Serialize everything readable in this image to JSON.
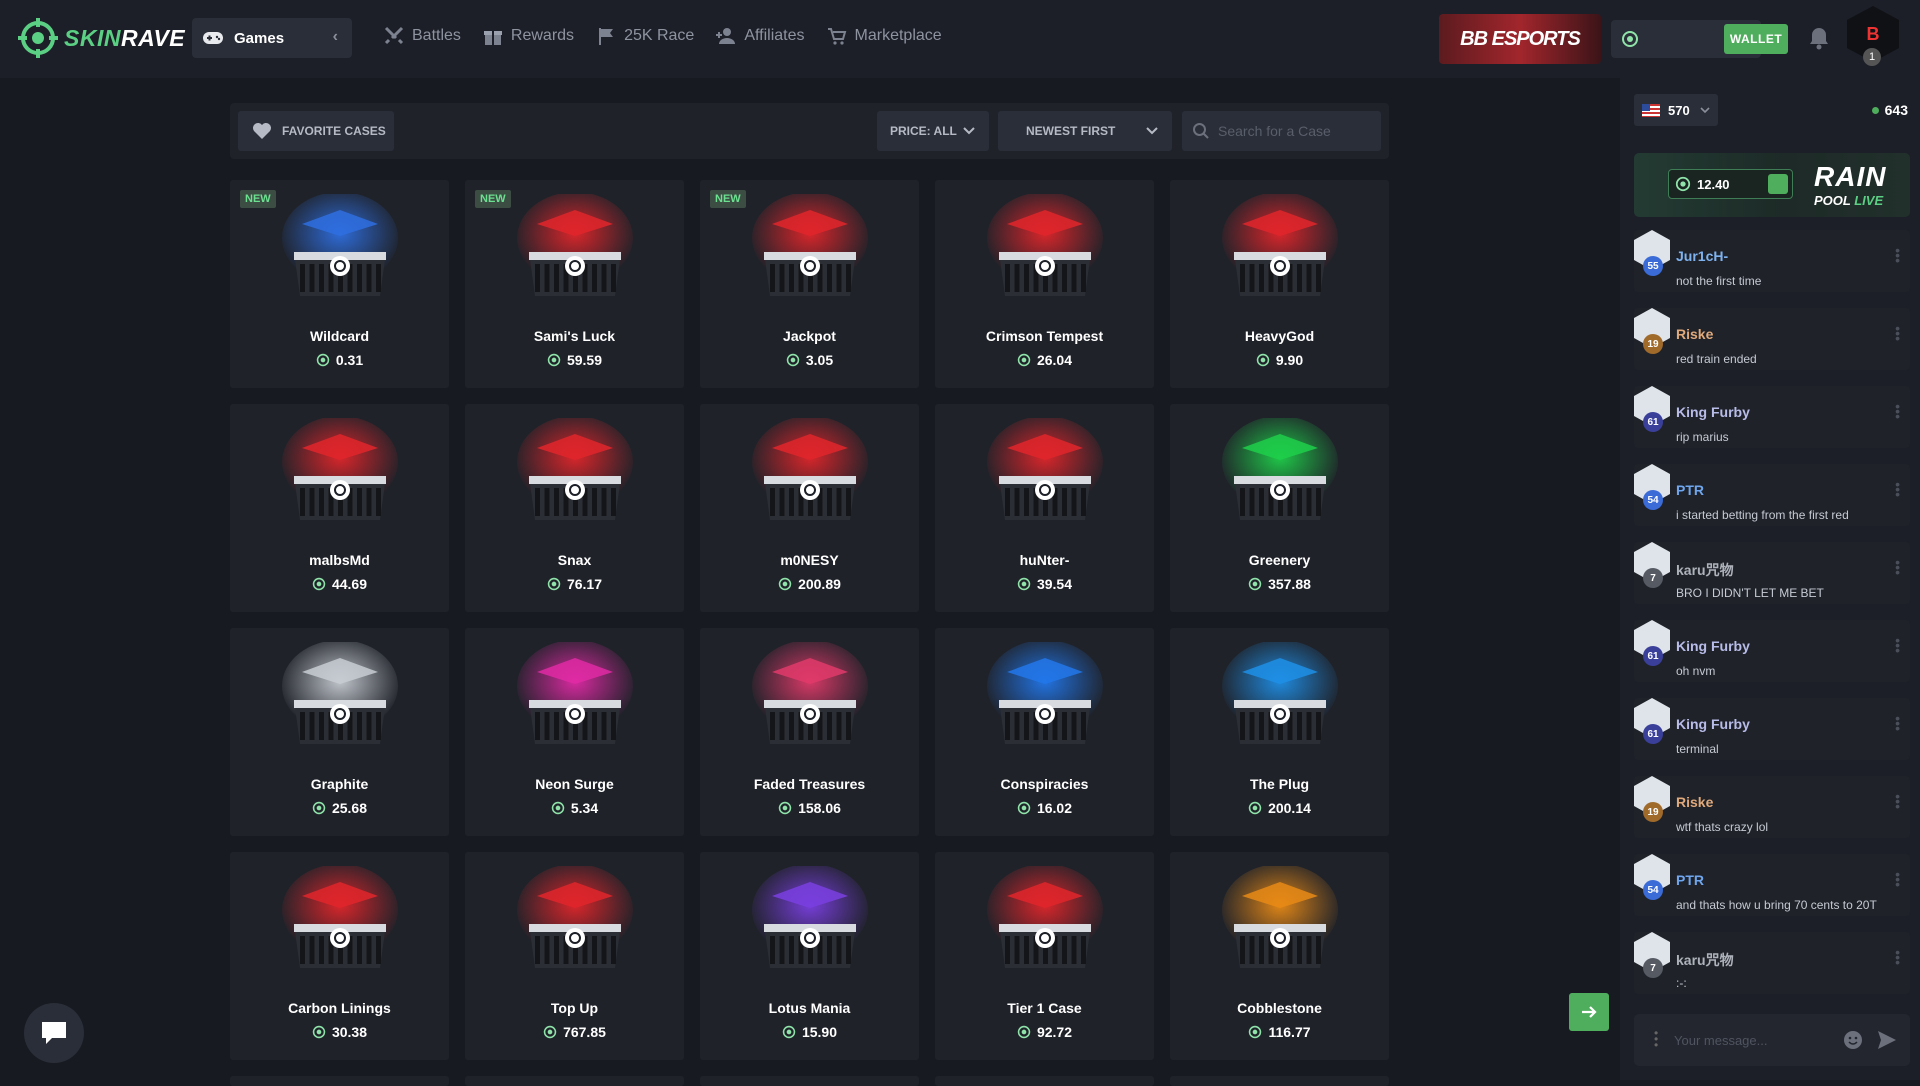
{
  "header": {
    "logo_text_a": "SKIN",
    "logo_text_b": "RAVE",
    "games_label": "Games",
    "nav": [
      {
        "label": "Battles",
        "icon": "swords-icon"
      },
      {
        "label": "Rewards",
        "icon": "gift-icon"
      },
      {
        "label": "25K Race",
        "icon": "flag-icon"
      },
      {
        "label": "Affiliates",
        "icon": "user-plus-icon"
      },
      {
        "label": "Marketplace",
        "icon": "cart-icon"
      }
    ],
    "banner_text": "BB ESPORTS",
    "wallet_label": "WALLET",
    "user_level": "1",
    "user_avatar_text": "B"
  },
  "toolbar": {
    "favorite_label": "FAVORITE CASES",
    "price_label": "PRICE: ALL",
    "sort_label": "NEWEST FIRST",
    "search_placeholder": "Search for a Case"
  },
  "cases": [
    {
      "name": "Wildcard",
      "price": "0.31",
      "new": "NEW",
      "color": "#2f6fe0"
    },
    {
      "name": "Sami's Luck",
      "price": "59.59",
      "new": "NEW",
      "color": "#e0262b"
    },
    {
      "name": "Jackpot",
      "price": "3.05",
      "new": "NEW",
      "color": "#e0262b"
    },
    {
      "name": "Crimson Tempest",
      "price": "26.04",
      "new": "",
      "color": "#e0262b"
    },
    {
      "name": "HeavyGod",
      "price": "9.90",
      "new": "",
      "color": "#e0262b"
    },
    {
      "name": "malbsMd",
      "price": "44.69",
      "new": "",
      "color": "#e0262b"
    },
    {
      "name": "Snax",
      "price": "76.17",
      "new": "",
      "color": "#e0262b"
    },
    {
      "name": "m0NESY",
      "price": "200.89",
      "new": "",
      "color": "#e0262b"
    },
    {
      "name": "huNter-",
      "price": "39.54",
      "new": "",
      "color": "#e0262b"
    },
    {
      "name": "Greenery",
      "price": "357.88",
      "new": "",
      "color": "#1fcf4a"
    },
    {
      "name": "Graphite",
      "price": "25.68",
      "new": "",
      "color": "#c8ccd3"
    },
    {
      "name": "Neon Surge",
      "price": "5.34",
      "new": "",
      "color": "#e02aa5"
    },
    {
      "name": "Faded Treasures",
      "price": "158.06",
      "new": "",
      "color": "#e03a6a"
    },
    {
      "name": "Conspiracies",
      "price": "16.02",
      "new": "",
      "color": "#2277ea"
    },
    {
      "name": "The Plug",
      "price": "200.14",
      "new": "",
      "color": "#1f8fe6"
    },
    {
      "name": "Carbon Linings",
      "price": "30.38",
      "new": "",
      "color": "#e0262b"
    },
    {
      "name": "Top Up",
      "price": "767.85",
      "new": "",
      "color": "#e0262b"
    },
    {
      "name": "Lotus Mania",
      "price": "15.90",
      "new": "",
      "color": "#7a3fe0"
    },
    {
      "name": "Tier 1 Case",
      "price": "92.72",
      "new": "",
      "color": "#e0262b"
    },
    {
      "name": "Cobblestone",
      "price": "116.77",
      "new": "",
      "color": "#e88a16"
    }
  ],
  "chat": {
    "lang_count": "570",
    "online_count": "643",
    "rain_amount": "12.40",
    "rain_title": "RAIN",
    "rain_pool": "POOL",
    "rain_live": "LIVE",
    "messages": [
      {
        "user": "Jur1cH-",
        "text": "not the first time",
        "level": "55",
        "user_color": "#7fb3f0",
        "level_color": "#3a6bd6"
      },
      {
        "user": "Riske",
        "text": "red train ended",
        "level": "19",
        "user_color": "#e0a97b",
        "level_color": "#a06a2a"
      },
      {
        "user": "King Furby",
        "text": "rip marius",
        "level": "61",
        "user_color": "#b8bce8",
        "level_color": "#3a3f9a"
      },
      {
        "user": "PTR",
        "text": "i started betting from the first red",
        "level": "54",
        "user_color": "#6fa6ee",
        "level_color": "#3a6bd6"
      },
      {
        "user": "karu咒物",
        "text": "BRO I DIDN'T LET ME BET",
        "level": "7",
        "user_color": "#aeb2ba",
        "level_color": "#555a63"
      },
      {
        "user": "King Furby",
        "text": "oh nvm",
        "level": "61",
        "user_color": "#b8bce8",
        "level_color": "#3a3f9a"
      },
      {
        "user": "King Furby",
        "text": "terminal",
        "level": "61",
        "user_color": "#b8bce8",
        "level_color": "#3a3f9a"
      },
      {
        "user": "Riske",
        "text": "wtf thats crazy lol",
        "level": "19",
        "user_color": "#e0a97b",
        "level_color": "#a06a2a"
      },
      {
        "user": "PTR",
        "text": "and thats how u bring 70 cents to 20T",
        "level": "54",
        "user_color": "#6fa6ee",
        "level_color": "#3a6bd6"
      },
      {
        "user": "karu咒物",
        "text": ":-:",
        "level": "7",
        "user_color": "#aeb2ba",
        "level_color": "#555a63"
      }
    ],
    "composer_placeholder": "Your message..."
  }
}
